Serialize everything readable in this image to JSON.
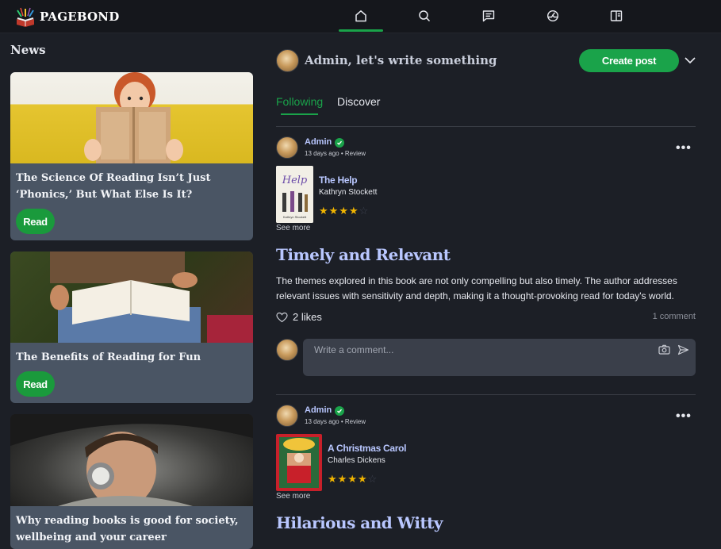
{
  "app": {
    "name": "PAGEBOND"
  },
  "nav": {
    "icons": [
      "home-icon",
      "search-icon",
      "message-icon",
      "dashboard-icon",
      "book-icon"
    ],
    "active": "home-icon"
  },
  "news": {
    "title": "News",
    "items": [
      {
        "title": "The Science Of Reading Isn’t Just ‘Phonics,’ But What Else Is It?",
        "button": "Read"
      },
      {
        "title": "The Benefits of Reading for Fun",
        "button": "Read"
      },
      {
        "title": "Why reading books is good for society, wellbeing and your career",
        "button": "Read"
      }
    ]
  },
  "compose": {
    "prompt": "Admin, let's write something",
    "create_label": "Create post"
  },
  "tabs": {
    "following": "Following",
    "discover": "Discover"
  },
  "posts": [
    {
      "author": "Admin",
      "meta": "13 days ago • Review",
      "book_title": "The Help",
      "book_author": "Kathryn Stockett",
      "cover_text": "Help",
      "cover_subtext": "Kathryn Stockett",
      "rating": 4,
      "see_more": "See more",
      "review_title": "Timely and Relevant",
      "review_body": "The themes explored in this book are not only compelling but also timely. The author addresses relevant issues with sensitivity and depth, making it a thought-provoking read for today's world.",
      "likes": "2 likes",
      "comments": "1 comment",
      "comment_placeholder": "Write a comment..."
    },
    {
      "author": "Admin",
      "meta": "13 days ago • Review",
      "book_title": "A Christmas Carol",
      "book_author": "Charles Dickens",
      "rating": 4,
      "see_more": "See more",
      "review_title": "Hilarious and Witty"
    }
  ],
  "colors": {
    "accent": "#1aa34a",
    "bg": "#1c1f26",
    "card": "#4a5564",
    "link": "#b9c7ff",
    "star": "#f0b400"
  }
}
